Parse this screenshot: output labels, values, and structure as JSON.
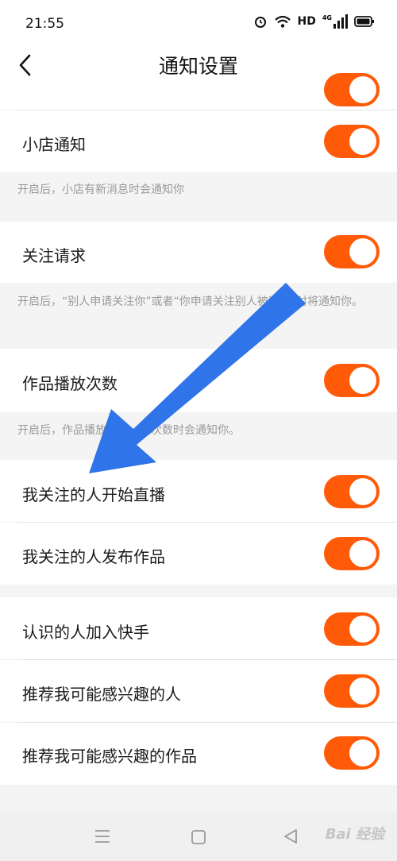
{
  "status_bar": {
    "time": "21:55",
    "network": "HD",
    "signal": "4G"
  },
  "header": {
    "title": "通知设置"
  },
  "settings": [
    {
      "label": "小店通知",
      "enabled": true
    },
    {
      "desc": "开启后，小店有新消息时会通知你"
    },
    {
      "label": "关注请求",
      "enabled": true
    },
    {
      "desc": "开启后，“别人申请关注你”或者“你申请关注别人被通过”时将通知你。"
    },
    {
      "label": "作品播放次数",
      "enabled": true
    },
    {
      "desc": "开启后，作品播放达到一定次数时会通知你。"
    },
    {
      "label": "我关注的人开始直播",
      "enabled": true
    },
    {
      "label": "我关注的人发布作品",
      "enabled": true
    },
    {
      "label": "认识的人加入快手",
      "enabled": true
    },
    {
      "label": "推荐我可能感兴趣的人",
      "enabled": true
    },
    {
      "label": "推荐我可能感兴趣的作品",
      "enabled": true
    }
  ],
  "watermark": "Bai 经验",
  "colors": {
    "toggle_on": "#ff5a07",
    "arrow": "#2f74e8"
  }
}
